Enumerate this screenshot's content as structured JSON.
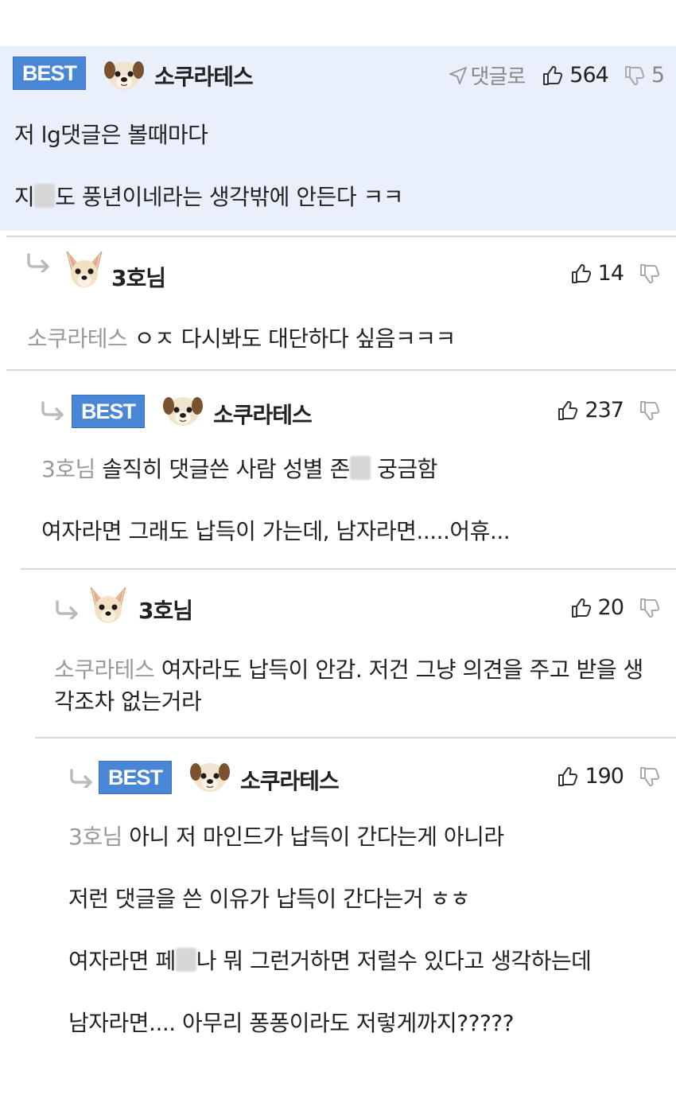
{
  "comments": [
    {
      "best": "BEST",
      "username": "소쿠라테스",
      "reply_label": "댓글로",
      "likes": "564",
      "dislikes": "5",
      "lines": [
        "저 lg댓글은 볼때마다",
        "지",
        "도 풍년이네라는 생각밖에 안든다 ㅋㅋ"
      ]
    },
    {
      "username": "3호님",
      "likes": "14",
      "mention": "소쿠라테스",
      "text": " ㅇㅈ 다시봐도 대단하다 싶음ㅋㅋㅋ"
    },
    {
      "best": "BEST",
      "username": "소쿠라테스",
      "likes": "237",
      "mention": "3호님",
      "text_a": " 솔직히 댓글쓴 사람 성별 존",
      "text_b": " 궁금함",
      "line2": "여자라면 그래도 납득이 가는데, 남자라면.....어휴..."
    },
    {
      "username": "3호님",
      "likes": "20",
      "mention": "소쿠라테스",
      "text": " 여자라도 납득이 안감. 저건 그냥 의견을 주고 받을 생각조차 없는거라"
    },
    {
      "best": "BEST",
      "username": "소쿠라테스",
      "likes": "190",
      "mention": "3호님",
      "text": " 아니 저 마인드가 납득이 간다는게 아니라",
      "line2": "저런 댓글을 쓴 이유가 납득이 간다는거 ㅎㅎ",
      "line3a": "여자라면 페",
      "line3b": "나 뭐 그런거하면 저럴수 있다고 생각하는데",
      "line4": "남자라면.... 아무리 퐁퐁이라도 저렇게까지?????"
    }
  ],
  "icons": {
    "avatar_1": "dog-face-avatar",
    "avatar_2": "chihuahua-avatar",
    "like": "thumbs-up-icon",
    "dislike": "thumbs-down-icon",
    "reply": "reply-arrow-icon",
    "send": "send-arrow-icon"
  },
  "colors": {
    "best_badge": "#4a86d6",
    "best_background": "#eaf0fb",
    "mention": "#999999"
  }
}
